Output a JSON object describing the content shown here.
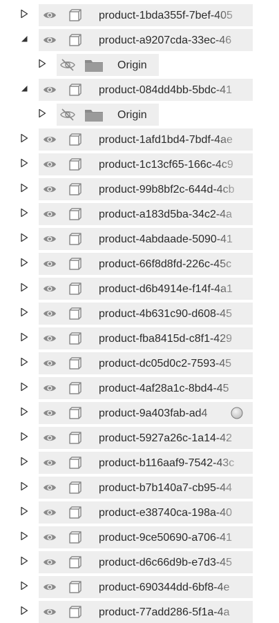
{
  "tree": {
    "rows": [
      {
        "level": 0,
        "expanded": false,
        "label": "product-1bda355f-7bef-405",
        "hidden": false
      },
      {
        "level": 0,
        "expanded": true,
        "label": "product-a9207cda-33ec-46",
        "hidden": false
      },
      {
        "level": 1,
        "expanded": false,
        "label": "Origin",
        "hidden": true,
        "icon": "folder-icon"
      },
      {
        "level": 0,
        "expanded": true,
        "label": "product-084dd4bb-5bdc-41",
        "hidden": false
      },
      {
        "level": 1,
        "expanded": false,
        "label": "Origin",
        "hidden": true,
        "icon": "folder-icon"
      },
      {
        "level": 0,
        "expanded": false,
        "label": "product-1afd1bd4-7bdf-4ae",
        "hidden": false
      },
      {
        "level": 0,
        "expanded": false,
        "label": "product-1c13cf65-166c-4c9",
        "hidden": false
      },
      {
        "level": 0,
        "expanded": false,
        "label": "product-99b8bf2c-644d-4cb",
        "hidden": false
      },
      {
        "level": 0,
        "expanded": false,
        "label": "product-a183d5ba-34c2-4a",
        "hidden": false
      },
      {
        "level": 0,
        "expanded": false,
        "label": "product-4abdaade-5090-41",
        "hidden": false
      },
      {
        "level": 0,
        "expanded": false,
        "label": "product-66f8d8fd-226c-45c",
        "hidden": false
      },
      {
        "level": 0,
        "expanded": false,
        "label": "product-d6b4914e-f14f-4a1",
        "hidden": false
      },
      {
        "level": 0,
        "expanded": false,
        "label": "product-4b631c90-d608-45",
        "hidden": false
      },
      {
        "level": 0,
        "expanded": false,
        "label": "product-fba8415d-c8f1-429",
        "hidden": false
      },
      {
        "level": 0,
        "expanded": false,
        "label": "product-dc05d0c2-7593-45",
        "hidden": false
      },
      {
        "level": 0,
        "expanded": false,
        "label": "product-4af28a1c-8bd4-45",
        "hidden": false
      },
      {
        "level": 0,
        "expanded": false,
        "label": "product-9a403fab-ad4",
        "hidden": false,
        "status": "status-circle-icon"
      },
      {
        "level": 0,
        "expanded": false,
        "label": "product-5927a26c-1a14-42",
        "hidden": false
      },
      {
        "level": 0,
        "expanded": false,
        "label": "product-b116aaf9-7542-43c",
        "hidden": false
      },
      {
        "level": 0,
        "expanded": false,
        "label": "product-b7b140a7-cb95-44",
        "hidden": false
      },
      {
        "level": 0,
        "expanded": false,
        "label": "product-e38740ca-198a-40",
        "hidden": false
      },
      {
        "level": 0,
        "expanded": false,
        "label": "product-9ce50690-a706-41",
        "hidden": false
      },
      {
        "level": 0,
        "expanded": false,
        "label": "product-d6c66d9b-e7d3-45",
        "hidden": false
      },
      {
        "level": 0,
        "expanded": false,
        "label": "product-690344dd-6bf8-4e",
        "hidden": false
      },
      {
        "level": 0,
        "expanded": false,
        "label": "product-77add286-5f1a-4a",
        "hidden": false
      }
    ]
  },
  "colors": {
    "row_bg": "#eeeeee",
    "icon": "#8a8a8a",
    "caret": "#333333"
  }
}
